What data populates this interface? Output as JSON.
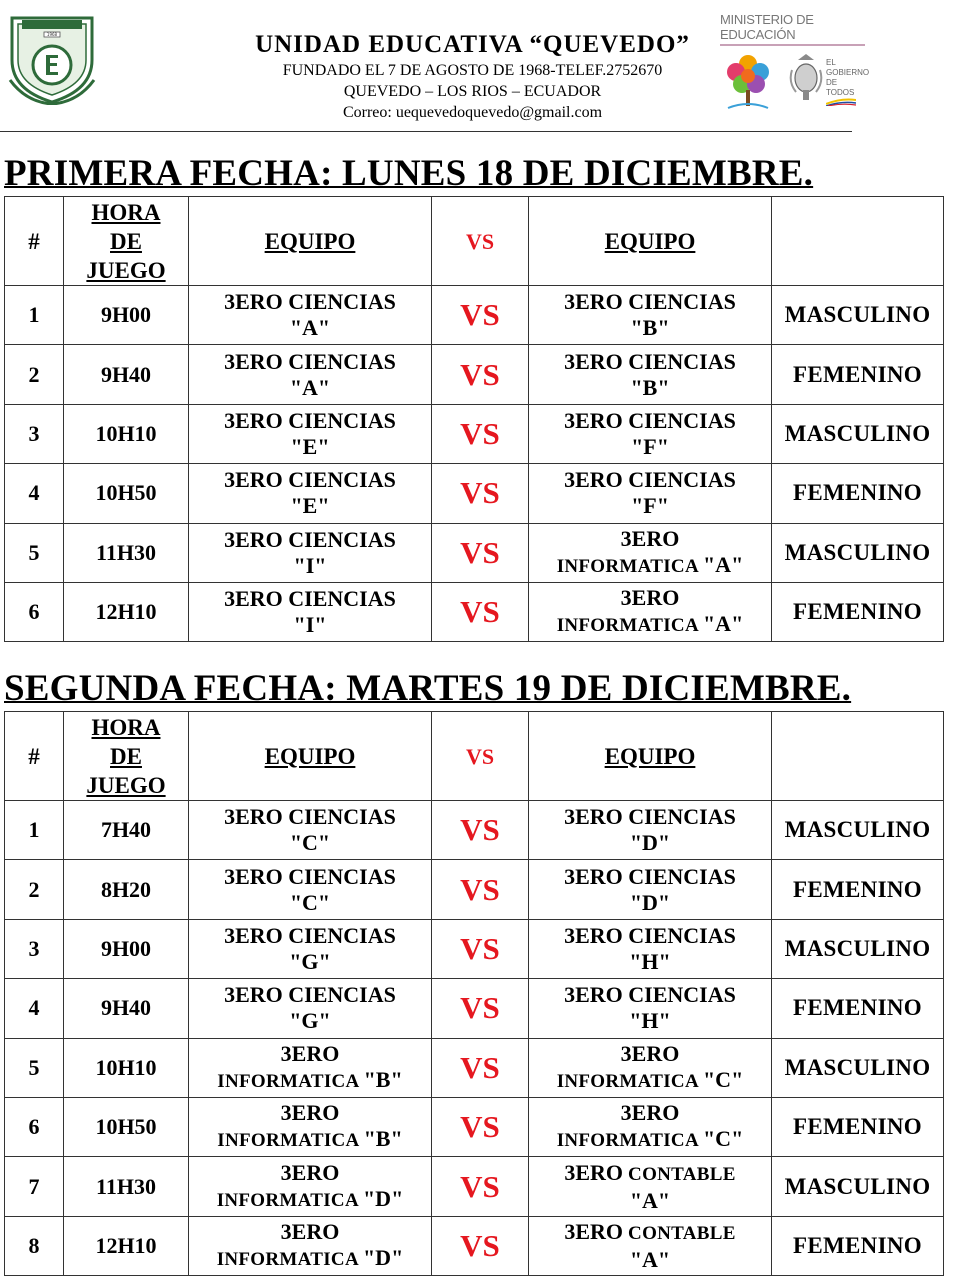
{
  "header": {
    "school_name": "UNIDAD EDUCATIVA “QUEVEDO”",
    "founded": "FUNDADO EL 7 DE AGOSTO DE 1968-TELEF.2752670",
    "location": "QUEVEDO – LOS RIOS – ECUADOR",
    "email": "Correo: uequevedoquevedo@gmail.com",
    "ministry": "MINISTERIO DE EDUCACIÓN",
    "gov_line1": "EL",
    "gov_line2": "GOBIERNO",
    "gov_line3": "DE TODOS",
    "logo_year": "1968"
  },
  "columns": {
    "num": "#",
    "time1": "HORA",
    "time2": "DE",
    "time3": "JUEGO",
    "team": "EQUIPO",
    "vs": "VS"
  },
  "colors": {
    "vs_red": "#e5171f",
    "ministry_gray": "#777777"
  },
  "sections": [
    {
      "title": "PRIMERA FECHA: LUNES 18 DE DICIEMBRE.",
      "matches": [
        {
          "n": "1",
          "time": "9H00",
          "a1": "3ERO CIENCIAS",
          "a2": "\"A\"",
          "vs": "VS",
          "b1": "3ERO CIENCIAS",
          "b2": "\"B\"",
          "cat": "MASCULINO"
        },
        {
          "n": "2",
          "time": "9H40",
          "a1": "3ERO CIENCIAS",
          "a2": "\"A\"",
          "vs": "VS",
          "b1": "3ERO CIENCIAS",
          "b2": "\"B\"",
          "cat": "FEMENINO"
        },
        {
          "n": "3",
          "time": "10H10",
          "a1": "3ERO CIENCIAS",
          "a2": "\"E\"",
          "vs": "VS",
          "b1": "3ERO CIENCIAS",
          "b2": "\"F\"",
          "cat": "MASCULINO"
        },
        {
          "n": "4",
          "time": "10H50",
          "a1": "3ERO CIENCIAS",
          "a2": "\"E\"",
          "vs": "VS",
          "b1": "3ERO CIENCIAS",
          "b2": "\"F\"",
          "cat": "FEMENINO"
        },
        {
          "n": "5",
          "time": "11H30",
          "a1": "3ERO CIENCIAS",
          "a2": "\"I\"",
          "vs": "VS",
          "b1": "3ERO",
          "b2s": "INFORMATICA ",
          "b2": "\"A\"",
          "cat": "MASCULINO"
        },
        {
          "n": "6",
          "time": "12H10",
          "a1": "3ERO CIENCIAS",
          "a2": "\"I\"",
          "vs": "VS",
          "b1": "3ERO",
          "b2s": "INFORMATICA ",
          "b2": "\"A\"",
          "cat": "FEMENINO"
        }
      ]
    },
    {
      "title": "SEGUNDA FECHA: MARTES 19 DE DICIEMBRE.",
      "matches": [
        {
          "n": "1",
          "time": "7H40",
          "a1": "3ERO CIENCIAS",
          "a2": "\"C\"",
          "vs": "VS",
          "b1": "3ERO CIENCIAS",
          "b2": "\"D\"",
          "cat": "MASCULINO"
        },
        {
          "n": "2",
          "time": "8H20",
          "a1": "3ERO CIENCIAS",
          "a2": "\"C\"",
          "vs": "VS",
          "b1": "3ERO CIENCIAS",
          "b2": "\"D\"",
          "cat": "FEMENINO"
        },
        {
          "n": "3",
          "time": "9H00",
          "a1": "3ERO CIENCIAS",
          "a2": "\"G\"",
          "vs": "VS",
          "b1": "3ERO CIENCIAS",
          "b2": "\"H\"",
          "cat": "MASCULINO"
        },
        {
          "n": "4",
          "time": "9H40",
          "a1": "3ERO CIENCIAS",
          "a2": "\"G\"",
          "vs": "VS",
          "b1": "3ERO CIENCIAS",
          "b2": "\"H\"",
          "cat": "FEMENINO"
        },
        {
          "n": "5",
          "time": "10H10",
          "a1": "3ERO",
          "a2s": "INFORMATICA ",
          "a2": "\"B\"",
          "vs": "VS",
          "b1": "3ERO",
          "b2s": "INFORMATICA ",
          "b2": "\"C\"",
          "cat": "MASCULINO"
        },
        {
          "n": "6",
          "time": "10H50",
          "a1": "3ERO",
          "a2s": "INFORMATICA ",
          "a2": "\"B\"",
          "vs": "VS",
          "b1": "3ERO",
          "b2s": "INFORMATICA ",
          "b2": "\"C\"",
          "cat": "FEMENINO"
        },
        {
          "n": "7",
          "time": "11H30",
          "a1": "3ERO",
          "a2s": "INFORMATICA ",
          "a2": "\"D\"",
          "vs": "VS",
          "b1": "3ERO",
          "b1s": " CONTABLE",
          "b2": "\"A\"",
          "cat": "MASCULINO"
        },
        {
          "n": "8",
          "time": "12H10",
          "a1": "3ERO",
          "a2s": "INFORMATICA ",
          "a2": "\"D\"",
          "vs": "VS",
          "b1": "3ERO",
          "b1s": " CONTABLE",
          "b2": "\"A\"",
          "cat": "FEMENINO"
        }
      ]
    }
  ]
}
